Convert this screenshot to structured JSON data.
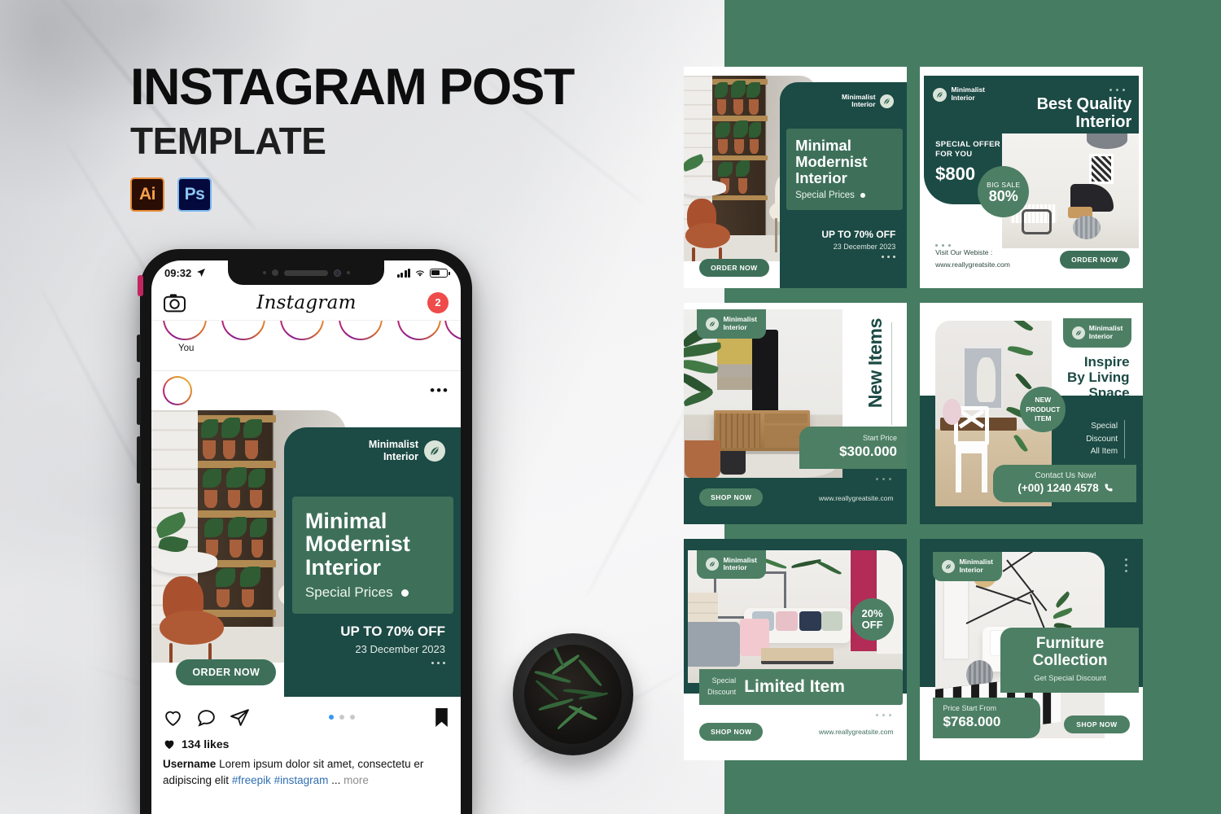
{
  "header": {
    "title": "INSTAGRAM POST",
    "subtitle": "TEMPLATE",
    "badges": [
      {
        "name": "illustrator-badge",
        "label": "Ai"
      },
      {
        "name": "photoshop-badge",
        "label": "Ps"
      }
    ]
  },
  "colors": {
    "panel_green": "#467c62",
    "dark_green": "#1c4a45",
    "mid_green": "#3e7059",
    "light_green": "#5b8a70",
    "white": "#ffffff",
    "notification_red": "#ef4b4b",
    "accent_blue": "#3897f0"
  },
  "phone": {
    "status_bar": {
      "time": "09:32",
      "location_icon": "location-arrow-icon",
      "signal_icon": "signal-bars-icon",
      "wifi_icon": "wifi-icon",
      "battery_icon": "battery-icon"
    },
    "app_header": {
      "camera_icon": "camera-icon",
      "logo": "Instagram",
      "notification_count": "2"
    },
    "stories": {
      "your_story_label": "You"
    },
    "post": {
      "options_icon": "more-options-icon",
      "actions": {
        "like_icon": "heart-icon",
        "comment_icon": "comment-icon",
        "share_icon": "send-icon",
        "save_icon": "bookmark-icon"
      },
      "likes": "134 likes",
      "username": "Username",
      "caption": "Lorem ipsum dolor sit amet, consectetu er adipiscing elit",
      "hashtags": "#freepik #instagram",
      "ellipsis": "...",
      "more": "more"
    }
  },
  "cards": [
    {
      "id": "card-minimal-modernist-interior",
      "brand": "Minimalist\nInterior",
      "brand_line1": "Minimalist",
      "brand_line2": "Interior",
      "title_lines": [
        "Minimal",
        "Modernist",
        "Interior"
      ],
      "subtitle": "Special Prices",
      "offer": "UP TO 70% OFF",
      "date": "23 December 2023",
      "button": "ORDER NOW"
    },
    {
      "id": "card-best-quality-interior",
      "brand_line1": "Minimalist",
      "brand_line2": "Interior",
      "title_lines": [
        "Best Quality",
        "Interior"
      ],
      "offer_label_line1": "SPECIAL OFFER",
      "offer_label_line2": "FOR YOU",
      "price": "$800",
      "badge_line1": "BIG SALE",
      "badge_line2": "80%",
      "website_label": "Visit Our Webiste :",
      "website": "www.reallygreatsite.com",
      "button": "ORDER NOW"
    },
    {
      "id": "card-new-items",
      "brand_line1": "Minimalist",
      "brand_line2": "Interior",
      "title": "New Items",
      "price_label": "Start Price",
      "price": "$300.000",
      "button": "SHOP NOW",
      "website": "www.reallygreatsite.com"
    },
    {
      "id": "card-inspire-by-living-space",
      "brand_line1": "Minimalist",
      "brand_line2": "Interior",
      "title_lines": [
        "Inspire",
        "By Living",
        "Space"
      ],
      "badge_lines": [
        "NEW",
        "PRODUCT",
        "ITEM"
      ],
      "discount_lines": [
        "Special",
        "Discount",
        "All Item"
      ],
      "contact_label": "Contact Us Now!",
      "phone": "(+00) 1240 4578",
      "phone_icon": "phone-icon"
    },
    {
      "id": "card-limited-item",
      "brand_line1": "Minimalist",
      "brand_line2": "Interior",
      "title": "Limited Item",
      "discount_line1": "Special",
      "discount_line2": "Discount",
      "badge_line1": "20%",
      "badge_line2": "OFF",
      "button": "SHOP NOW",
      "website": "www.reallygreatsite.com"
    },
    {
      "id": "card-furniture-collection",
      "brand_line1": "Minimalist",
      "brand_line2": "Interior",
      "title_lines": [
        "Furniture",
        "Collection"
      ],
      "subtitle": "Get Special Discount",
      "price_label": "Price Start From",
      "price": "$768.000",
      "button": "SHOP NOW"
    }
  ]
}
